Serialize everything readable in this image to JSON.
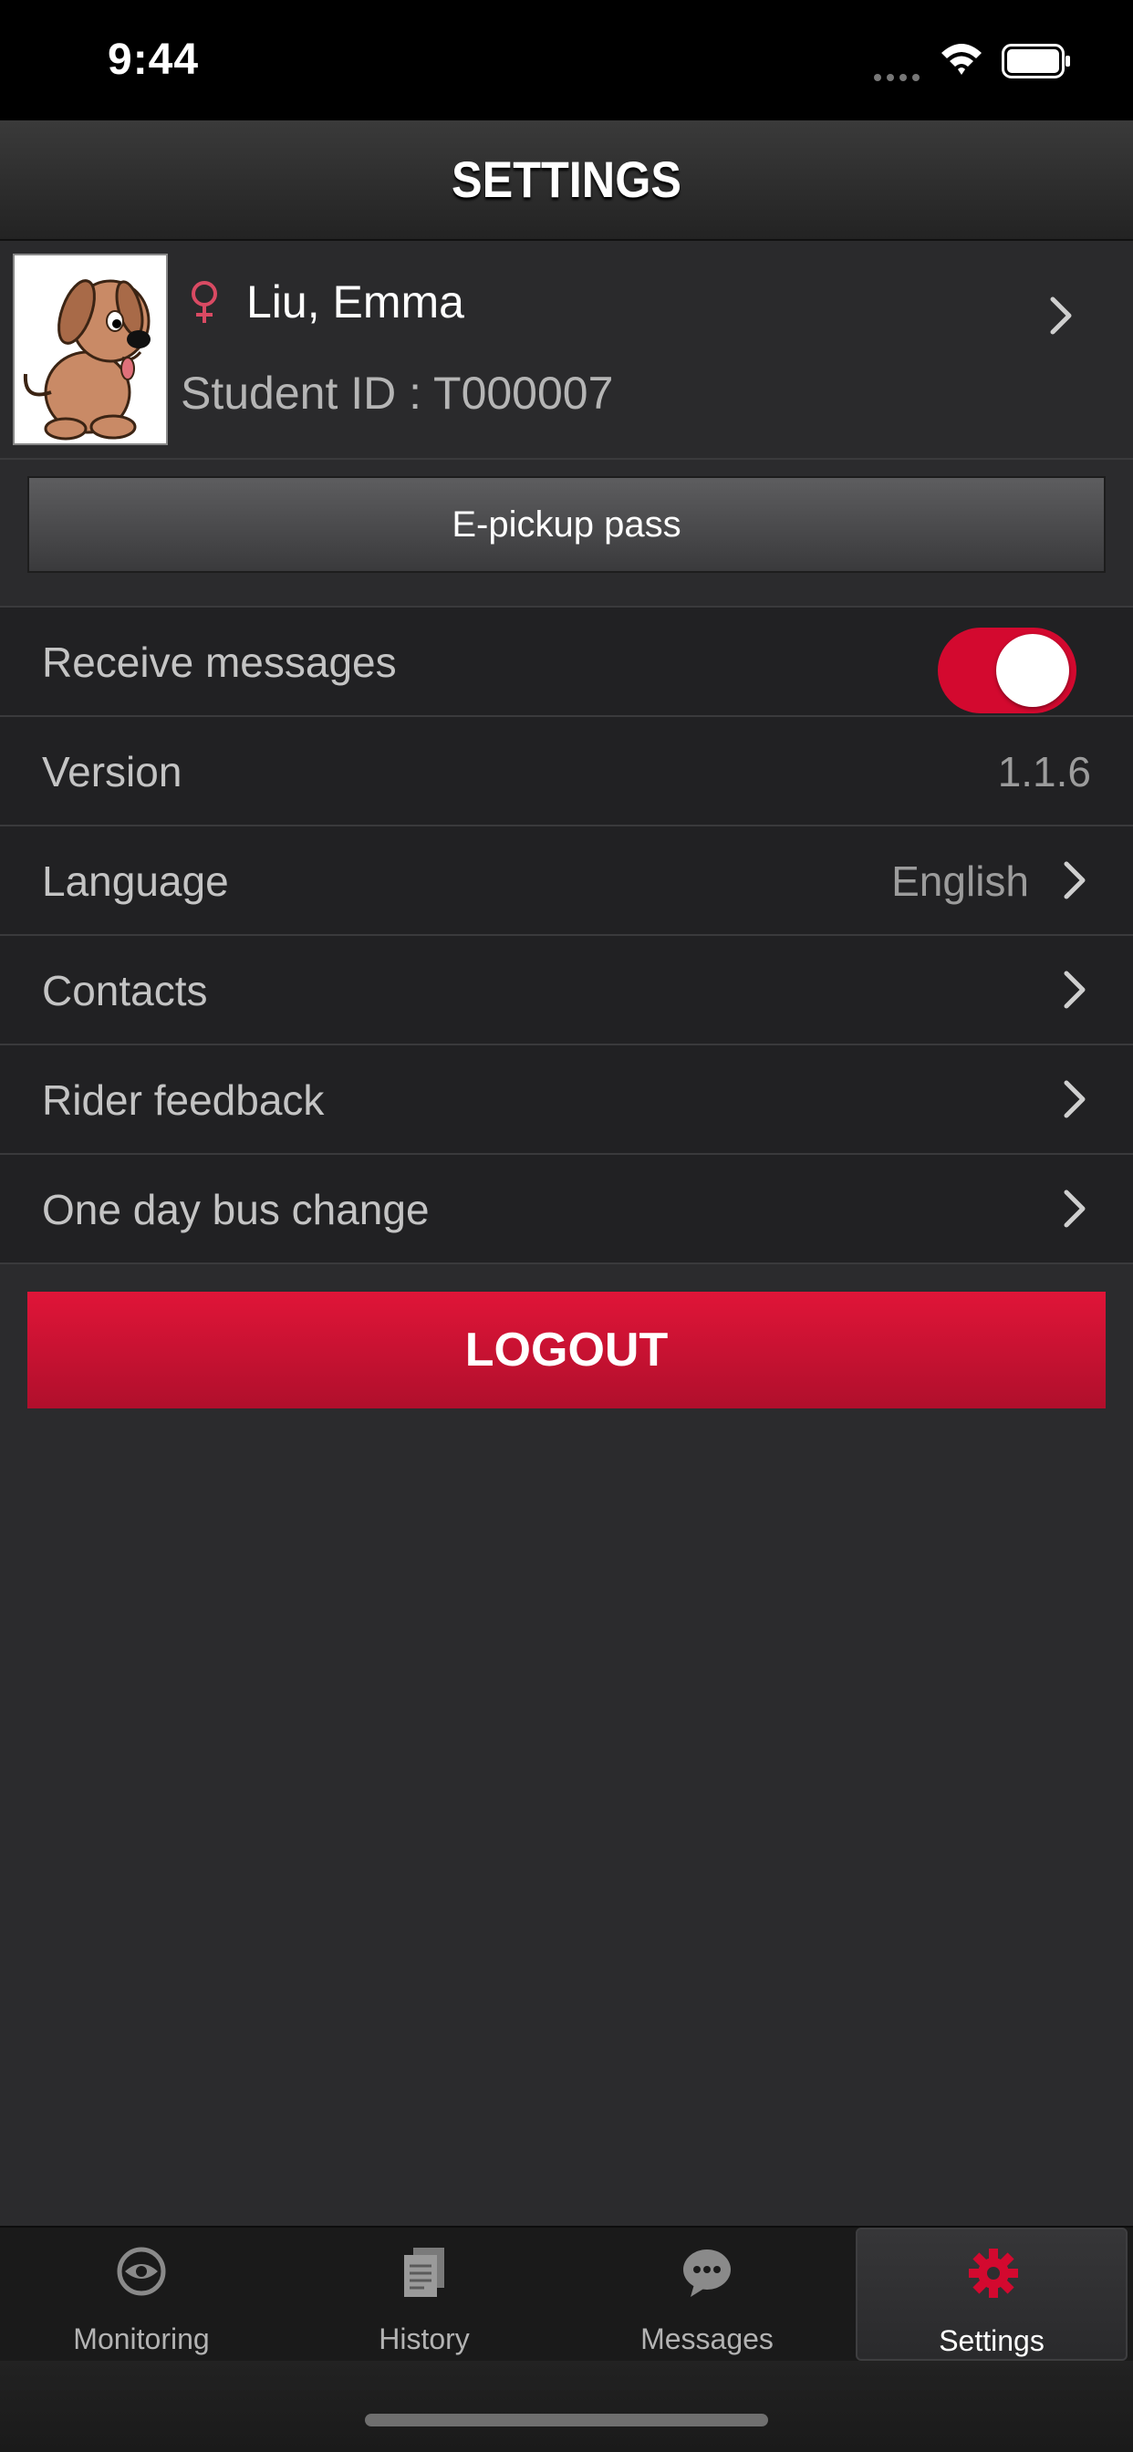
{
  "status_bar": {
    "time": "9:44"
  },
  "header": {
    "title": "SETTINGS"
  },
  "profile": {
    "name": "Liu, Emma",
    "student_id": "Student ID : T000007"
  },
  "epickup": {
    "label": "E-pickup pass"
  },
  "settings": {
    "receive_messages": {
      "label": "Receive messages",
      "enabled": true
    },
    "version": {
      "label": "Version",
      "value": "1.1.6"
    },
    "language": {
      "label": "Language",
      "value": "English"
    },
    "contacts": {
      "label": "Contacts"
    },
    "rider_feedback": {
      "label": "Rider feedback"
    },
    "bus_change": {
      "label": "One day bus change"
    }
  },
  "logout": {
    "label": "LOGOUT"
  },
  "tabs": [
    {
      "label": "Monitoring",
      "icon": "monitoring-icon"
    },
    {
      "label": "History",
      "icon": "history-icon"
    },
    {
      "label": "Messages",
      "icon": "messages-icon"
    },
    {
      "label": "Settings",
      "icon": "settings-gear-icon",
      "active": true
    }
  ],
  "colors": {
    "accent": "#d3092f",
    "background": "#2b2b2d",
    "row": "#212123"
  }
}
